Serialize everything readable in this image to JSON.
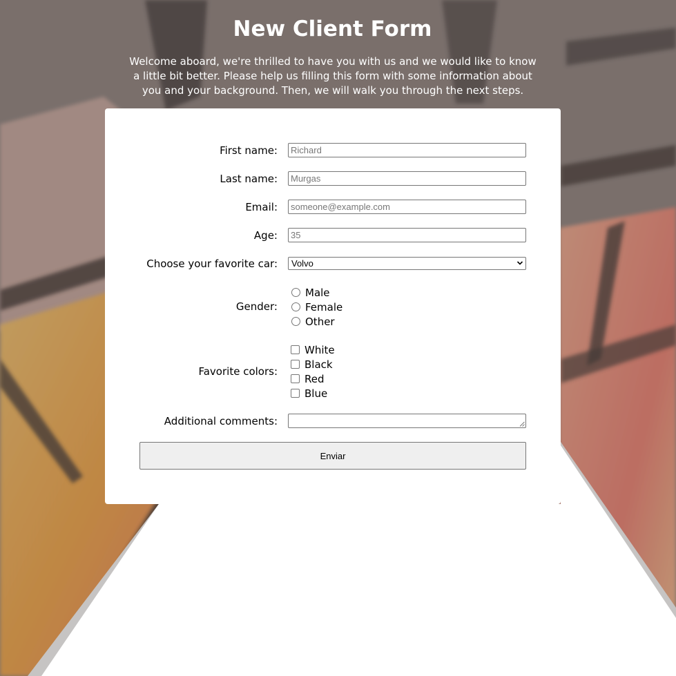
{
  "header": {
    "title": "New Client Form",
    "intro": "Welcome aboard, we're thrilled to have you with us and we would like to know a little bit better. Please help us filling this form with some information about you and your background. Then, we will walk you through the next steps."
  },
  "form": {
    "first_name": {
      "label": "First name:",
      "placeholder": "Richard"
    },
    "last_name": {
      "label": "Last name:",
      "placeholder": "Murgas"
    },
    "email": {
      "label": "Email:",
      "placeholder": "someone@example.com"
    },
    "age": {
      "label": "Age:",
      "placeholder": "35"
    },
    "car": {
      "label": "Choose your favorite car:",
      "selected": "Volvo"
    },
    "gender": {
      "label": "Gender:",
      "options": [
        "Male",
        "Female",
        "Other"
      ]
    },
    "colors": {
      "label": "Favorite colors:",
      "options": [
        "White",
        "Black",
        "Red",
        "Blue"
      ]
    },
    "comments": {
      "label": "Additional comments:"
    },
    "submit_label": "Enviar"
  },
  "icons": {
    "select_arrow": "chevron-down-icon",
    "resize_grip": "resize-grip-icon"
  },
  "colors": {
    "overlay": "#6b6462",
    "card": "#ffffff",
    "button": "#efefef",
    "accent_orange": "#f5a23c",
    "accent_pink": "#f07a6a"
  }
}
